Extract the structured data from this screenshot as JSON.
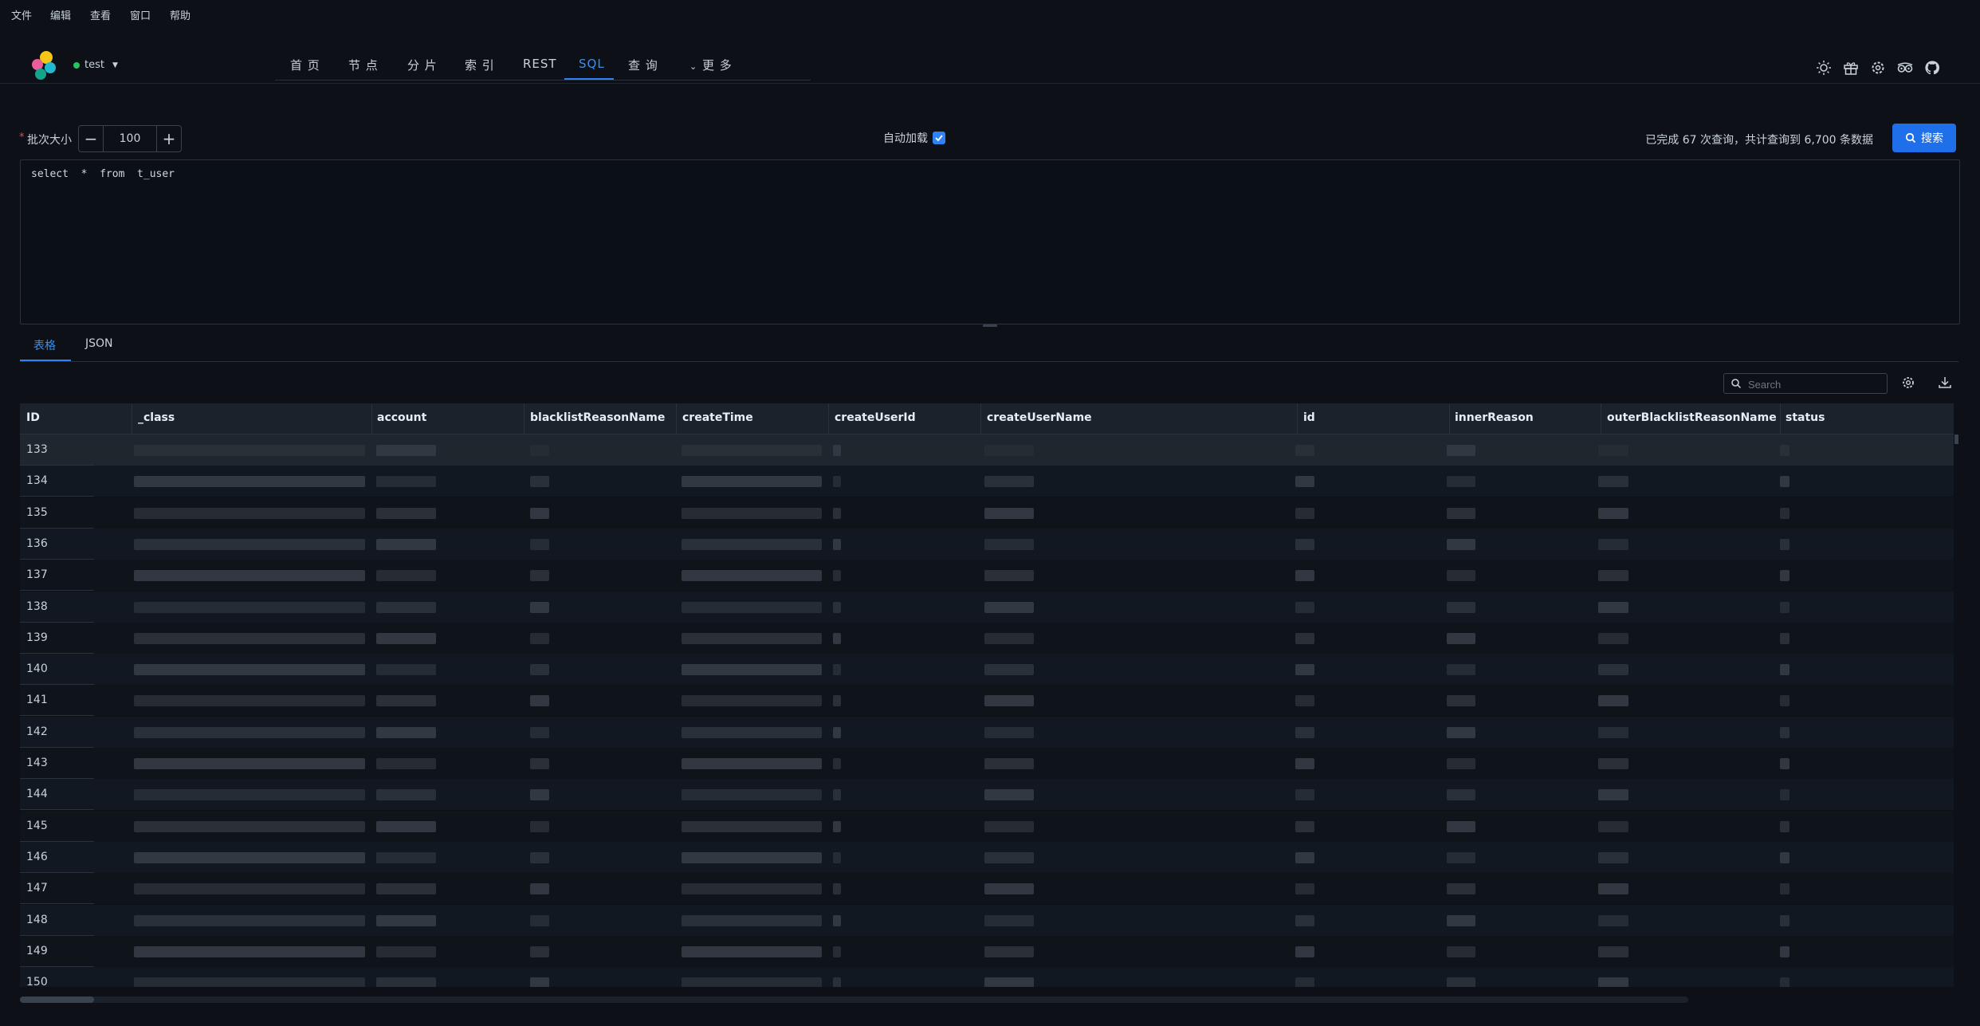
{
  "menu": [
    "文件",
    "编辑",
    "查看",
    "窗口",
    "帮助"
  ],
  "cluster": {
    "name": "test",
    "status_color": "#22c55e"
  },
  "nav": [
    "首 页",
    "节 点",
    "分 片",
    "索 引",
    "REST",
    "SQL",
    "查 询",
    "更 多"
  ],
  "nav_active": "SQL",
  "header_icons": [
    "sun-icon",
    "gift-icon",
    "settings-icon",
    "tripadvisor-icon",
    "github-icon"
  ],
  "toolbar": {
    "required_mark": "*",
    "batch_label": "批次大小",
    "minus": "−",
    "plus": "+",
    "batch_value": "100",
    "auto_load_label": "自动加载",
    "auto_load_checked": true,
    "stats": "已完成 67 次查询，共计查询到 6,700 条数据",
    "search_label": "搜索"
  },
  "editor": {
    "sql": "select  *  from  t_user"
  },
  "result_tabs": [
    "表格",
    "JSON"
  ],
  "table": {
    "search_placeholder": "Search",
    "columns": [
      "ID",
      "_class",
      "account",
      "blacklistReasonName",
      "createTime",
      "createUserId",
      "createUserName",
      "id",
      "innerReason",
      "outerBlacklistReasonName",
      "status"
    ],
    "row_ids": [
      "133",
      "134",
      "135",
      "136",
      "137",
      "138",
      "139",
      "140",
      "141",
      "142",
      "143",
      "144",
      "145",
      "146",
      "147",
      "148",
      "149",
      "150"
    ]
  },
  "colors": {
    "background": "#0d1117",
    "accent": "#2f81f7",
    "header_row": "#1b222c"
  }
}
